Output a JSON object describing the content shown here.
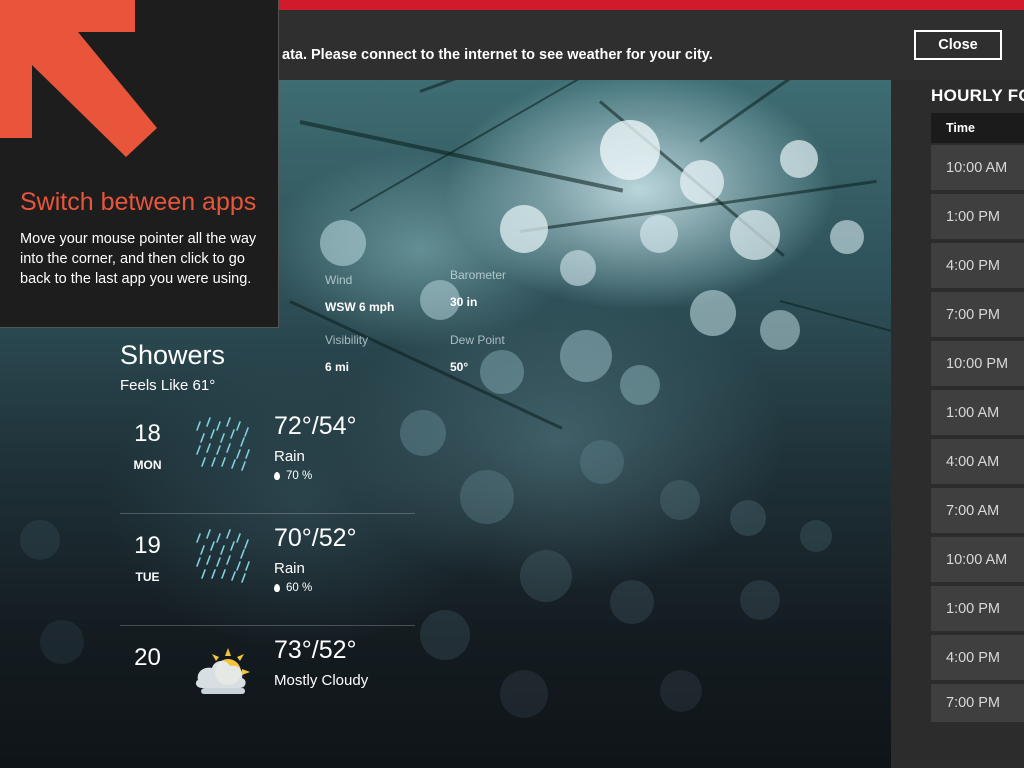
{
  "banner": {
    "message": "ata. Please connect to the internet to see weather for your city.",
    "close_label": "Close"
  },
  "tip": {
    "arrow_icon": "arrow-up-left-icon",
    "title": "Switch between apps",
    "body": "Move your mouse pointer all the way into the corner, and then click to go back to the last app you were using."
  },
  "current": {
    "details": [
      {
        "label": "Wind",
        "value": "WSW 6 mph"
      },
      {
        "label": "Barometer",
        "value": "30 in"
      },
      {
        "label": "Visibility",
        "value": "6 mi"
      },
      {
        "label": "Dew Point",
        "value": "50°"
      }
    ],
    "condition": "Showers",
    "feels_like": "Feels Like 61°"
  },
  "forecast": [
    {
      "day": "18",
      "weekday": "MON",
      "icon": "rain-icon",
      "temps": "72°/54°",
      "desc": "Rain",
      "precip": "70 %"
    },
    {
      "day": "19",
      "weekday": "TUE",
      "icon": "rain-icon",
      "temps": "70°/52°",
      "desc": "Rain",
      "precip": "60 %"
    },
    {
      "day": "20",
      "weekday": "",
      "icon": "mostly-cloudy-icon",
      "temps": "73°/52°",
      "desc": "Mostly Cloudy",
      "precip": ""
    }
  ],
  "hourly": {
    "title": "HOURLY FO",
    "column": "Time",
    "times": [
      "10:00 AM",
      "1:00 PM",
      "4:00 PM",
      "7:00 PM",
      "10:00 PM",
      "1:00 AM",
      "4:00 AM",
      "7:00 AM",
      "10:00 AM",
      "1:00 PM",
      "4:00 PM",
      "7:00 PM"
    ]
  },
  "colors": {
    "accent_red": "#d11a2a",
    "tip_title": "#e8553a",
    "tip_arrow": "#e8553a"
  }
}
